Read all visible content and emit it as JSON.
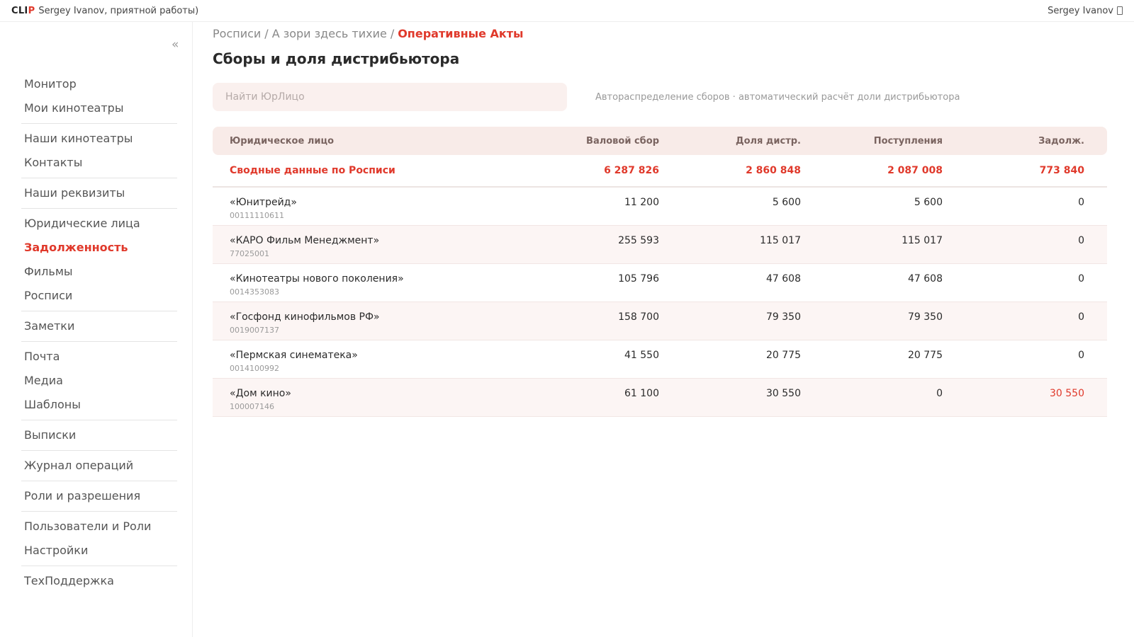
{
  "header": {
    "logo_main": "CLI",
    "logo_accent": "P",
    "greeting": "Sergey Ivanov, приятной работы)",
    "user_name": "Sergey Ivanov"
  },
  "sidebar": {
    "collapse_label": "«",
    "groups": [
      {
        "items": [
          {
            "label": "Монитор"
          },
          {
            "label": "Мои кинотеатры"
          }
        ]
      },
      {
        "items": [
          {
            "label": "Наши кинотеатры"
          },
          {
            "label": "Контакты"
          }
        ]
      },
      {
        "items": [
          {
            "label": "Наши реквизиты"
          }
        ]
      },
      {
        "items": [
          {
            "label": "Юридические лица"
          },
          {
            "label": "Задолженность",
            "active": true
          },
          {
            "label": "Фильмы"
          },
          {
            "label": "Росписи"
          }
        ]
      },
      {
        "items": [
          {
            "label": "Заметки"
          }
        ]
      },
      {
        "items": [
          {
            "label": "Почта"
          },
          {
            "label": "Медиа"
          },
          {
            "label": "Шаблоны"
          }
        ]
      },
      {
        "items": [
          {
            "label": "Выписки"
          }
        ]
      },
      {
        "items": [
          {
            "label": "Журнал операций"
          }
        ]
      },
      {
        "items": [
          {
            "label": "Роли и разрешения"
          }
        ]
      },
      {
        "items": [
          {
            "label": "Пользователи и Роли"
          },
          {
            "label": "Настройки"
          }
        ]
      },
      {
        "items": [
          {
            "label": "ТехПоддержка"
          }
        ]
      }
    ]
  },
  "breadcrumb": {
    "items": [
      "Росписи",
      "А зори здесь тихие"
    ],
    "separator": "/",
    "current": "Оперативные Акты"
  },
  "page": {
    "title": "Сборы и доля дистрибьютора"
  },
  "search": {
    "placeholder": "Найти ЮрЛицо",
    "value": ""
  },
  "hint": "Автораспределение сборов · автоматический расчёт доли дистрибьютора",
  "table": {
    "columns": [
      "Юридическое лицо",
      "Валовой сбор",
      "Доля дистр.",
      "Поступления",
      "Задолж."
    ],
    "summary": {
      "label": "Сводные данные по Росписи",
      "gross": "6 287 826",
      "share": "2 860 848",
      "received": "2 087 008",
      "debt": "773 840"
    },
    "rows": [
      {
        "name": "«Юнитрейд»",
        "code": "00111110611",
        "gross": "11 200",
        "share": "5 600",
        "received": "5 600",
        "debt": "0"
      },
      {
        "name": "«КАРО Фильм Менеджмент»",
        "code": "77025001",
        "gross": "255 593",
        "share": "115 017",
        "received": "115 017",
        "debt": "0"
      },
      {
        "name": "«Кинотеатры нового поколения»",
        "code": "0014353083",
        "gross": "105 796",
        "share": "47 608",
        "received": "47 608",
        "debt": "0"
      },
      {
        "name": "«Госфонд кинофильмов РФ»",
        "code": "0019007137",
        "gross": "158 700",
        "share": "79 350",
        "received": "79 350",
        "debt": "0"
      },
      {
        "name": "«Пермская синематека»",
        "code": "0014100992",
        "gross": "41 550",
        "share": "20 775",
        "received": "20 775",
        "debt": "0"
      },
      {
        "name": "«Дом кино»",
        "code": "100007146",
        "gross": "61 100",
        "share": "30 550",
        "received": "0",
        "debt": "30 550"
      }
    ]
  },
  "colors": {
    "accent": "#e0392b",
    "header_bg": "#f8ebe8",
    "row_alt_bg": "#fcf5f4",
    "search_bg": "#faf0ee"
  }
}
